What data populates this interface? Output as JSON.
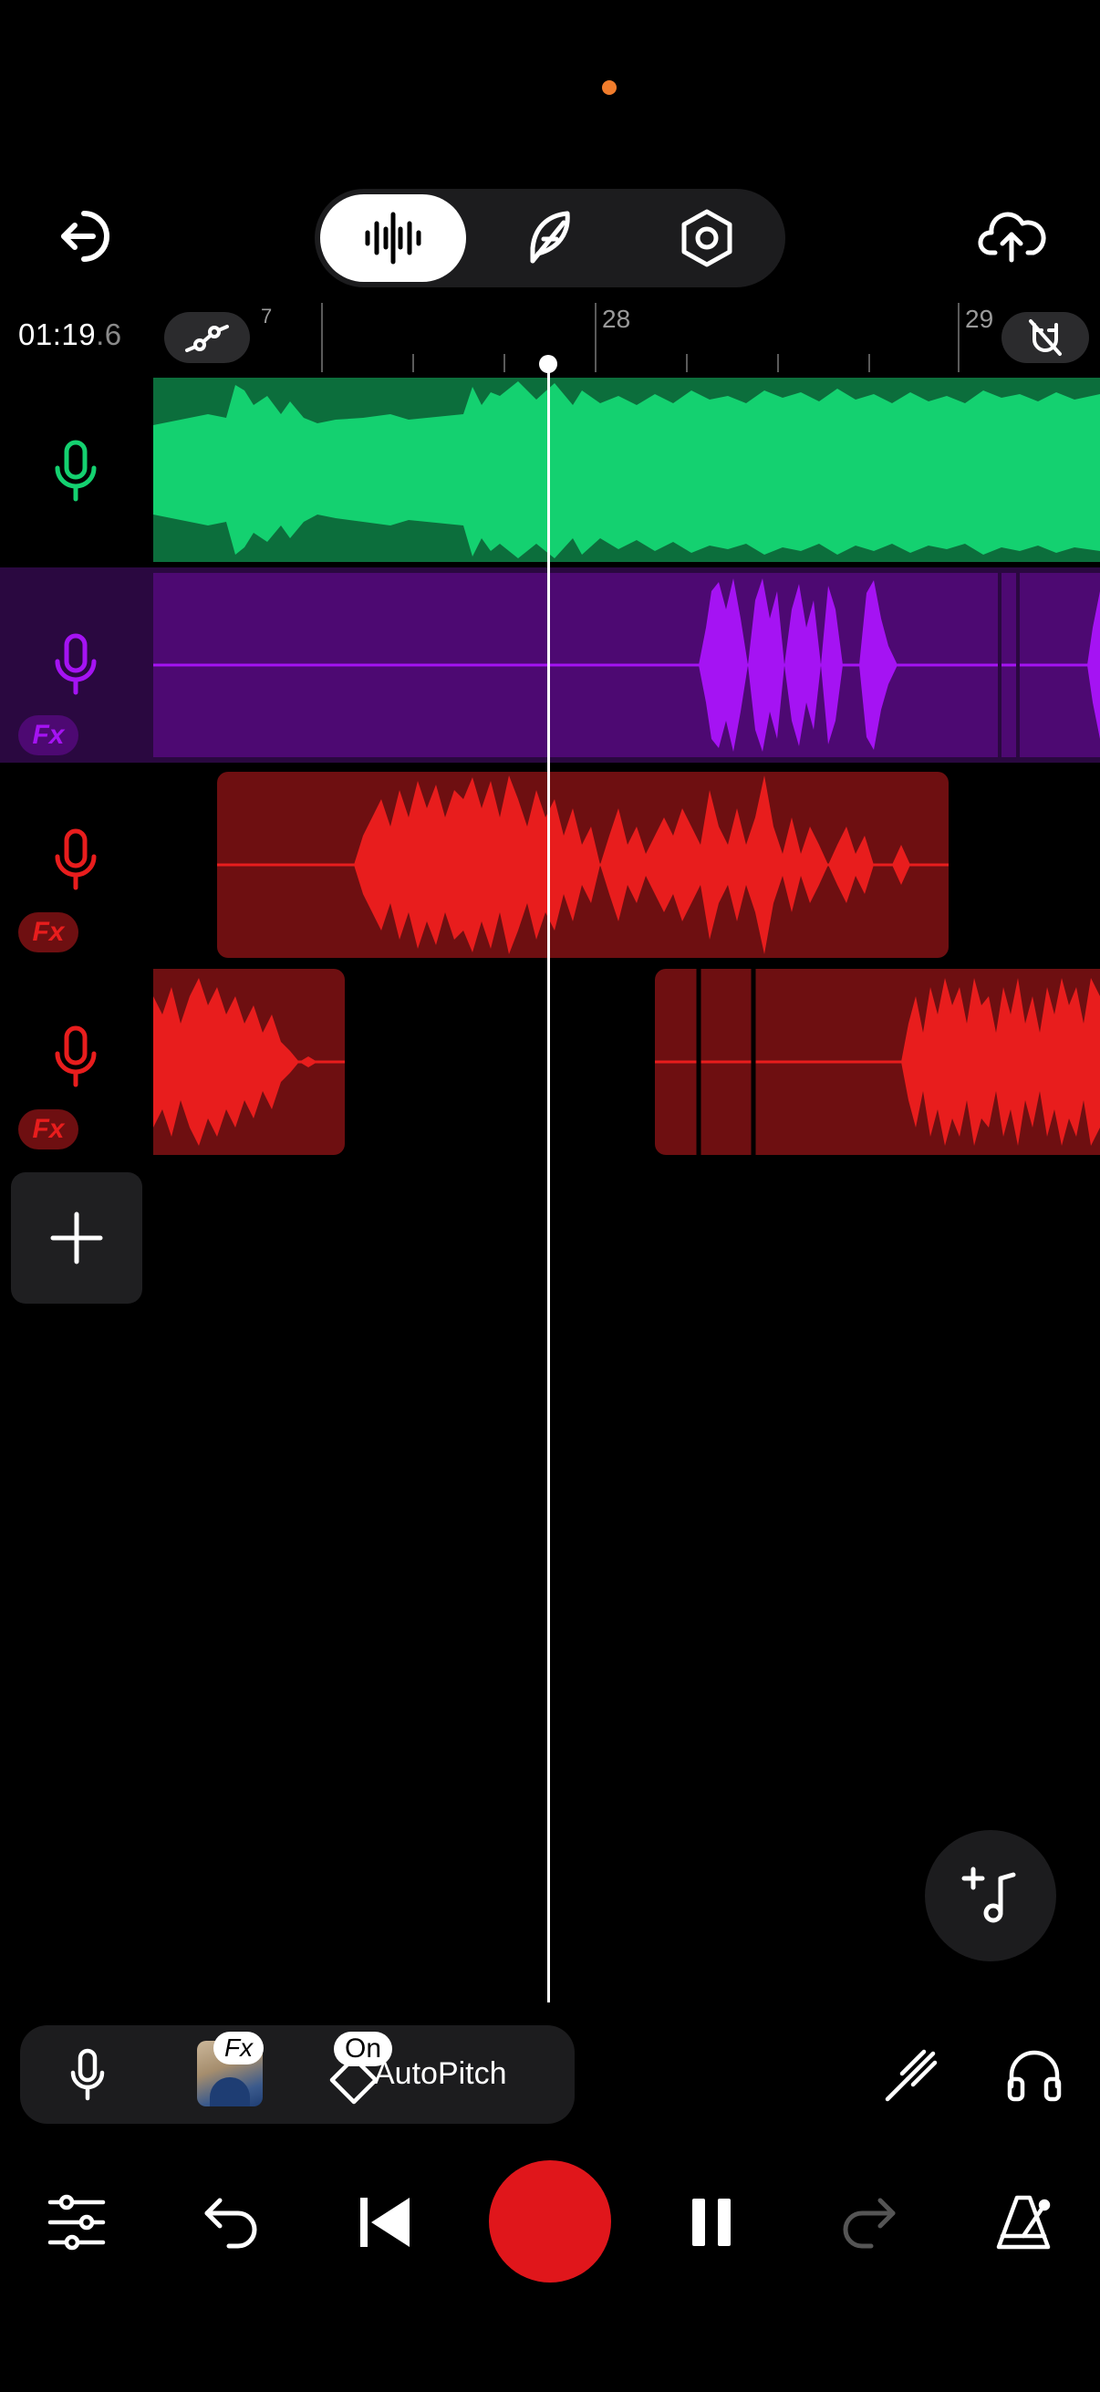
{
  "status": {
    "indicator_color": "#f07c2c"
  },
  "header": {
    "back_icon": "exit-icon",
    "modes": [
      {
        "name": "waveform-icon",
        "active": true
      },
      {
        "name": "feather-icon",
        "active": false
      },
      {
        "name": "settings-hex-icon",
        "active": false
      }
    ],
    "upload_icon": "cloud-upload-icon"
  },
  "timeline": {
    "time_main": "01:19",
    "time_fraction": ".6",
    "ruler_labels": {
      "prev": "7",
      "mid": "28",
      "next": "29"
    },
    "automation_icon": "automation-curve-icon",
    "magnet_icon": "magnet-off-icon"
  },
  "tracks": [
    {
      "name": "track-1",
      "color": "#14d170",
      "dark": "#0c6e3c",
      "fx": false
    },
    {
      "name": "track-2",
      "color": "#a513f3",
      "dark": "#4d0972",
      "fx": true,
      "fx_label": "Fx",
      "selected": true
    },
    {
      "name": "track-3",
      "color": "#e81d1d",
      "dark": "#6e0f11",
      "fx": true,
      "fx_label": "Fx"
    },
    {
      "name": "track-4",
      "color": "#e81d1d",
      "dark": "#6e0f11",
      "fx": true,
      "fx_label": "Fx"
    }
  ],
  "bottom_bar": {
    "fx_badge": "Fx",
    "on_badge": "On",
    "autopitch_label": "AutoPitch",
    "icons": [
      "mic-icon",
      "effect-thumbnail",
      "autopitch-tag-icon",
      "tuning-fork-icon",
      "headphones-icon"
    ]
  },
  "transport": {
    "icons": [
      "mixer-sliders-icon",
      "undo-icon",
      "skip-back-icon",
      "record-button",
      "pause-icon",
      "redo-icon",
      "metronome-icon"
    ],
    "record_color": "#e0161b"
  }
}
